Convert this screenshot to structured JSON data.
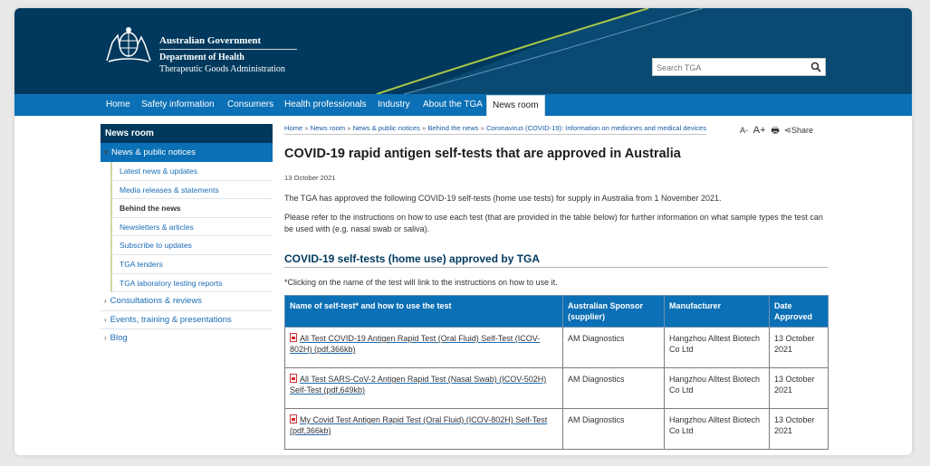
{
  "header": {
    "gov_title": "Australian Government",
    "dept": "Department of Health",
    "agency": "Therapeutic Goods Administration",
    "search_placeholder": "Search TGA"
  },
  "nav": {
    "items": [
      "Home",
      "Safety information",
      "Consumers",
      "Health professionals",
      "Industry",
      "About the TGA",
      "News room"
    ],
    "active": "News room"
  },
  "sidebar": {
    "title": "News room",
    "selected": "News & public notices",
    "sub_items": [
      "Latest news & updates",
      "Media releases & statements",
      "Behind the news",
      "Newsletters & articles",
      "Subscribe to updates",
      "TGA tenders",
      "TGA laboratory testing reports"
    ],
    "sub_current": "Behind the news",
    "top_items": [
      "Consultations & reviews",
      "Events, training & presentations",
      "Blog"
    ]
  },
  "breadcrumb": [
    "Home",
    "News room",
    "News & public notices",
    "Behind the news",
    "Coronavirus (COVID-19): Information on medicines and medical devices"
  ],
  "tools": {
    "decrease": "A-",
    "increase": "A+",
    "share": "Share"
  },
  "article": {
    "title": "COVID-19 rapid antigen self-tests that are approved in Australia",
    "date": "13 October 2021",
    "para1": "The TGA has approved the following COVID-19 self-tests (home use tests) for supply in Australia from 1 November 2021.",
    "para2": "Please refer to the instructions on how to use each test (that are provided in the table below) for further information on what sample types the test can be used with (e.g. nasal swab or saliva).",
    "section_title": "COVID-19 self-tests (home use) approved by TGA",
    "note": "*Clicking on the name of the test will link to the instructions on how to use it."
  },
  "table": {
    "headers": [
      "Name of self-test* and how to use the test",
      "Australian Sponsor (supplier)",
      "Manufacturer",
      "Date Approved"
    ],
    "rows": [
      [
        "All Test COVID-19 Antigen Rapid Test (Oral Fluid) Self-Test (ICOV-802H) (pdf,366kb)",
        "AM Diagnostics",
        "Hangzhou Alltest Biotech Co Ltd",
        "13 October 2021"
      ],
      [
        "All Test SARS-CoV-2 Antigen Rapid Test (Nasal Swab) (ICOV-502H) Self-Test (pdf,649kb)",
        "AM Diagnostics",
        "Hangzhou Alltest Biotech Co Ltd",
        "13 October 2021"
      ],
      [
        "My Covid Test Antigen Rapid Test (Oral Fluid) (ICOV-802H) Self-Test (pdf,366kb)",
        "AM Diagnostics",
        "Hangzhou Alltest Biotech Co Ltd",
        "13 October 2021"
      ]
    ]
  },
  "colors": {
    "header_bg": "#00395d",
    "nav_bg": "#0b70b5",
    "swoosh": "#a8c64a",
    "link": "#1a6db5"
  }
}
